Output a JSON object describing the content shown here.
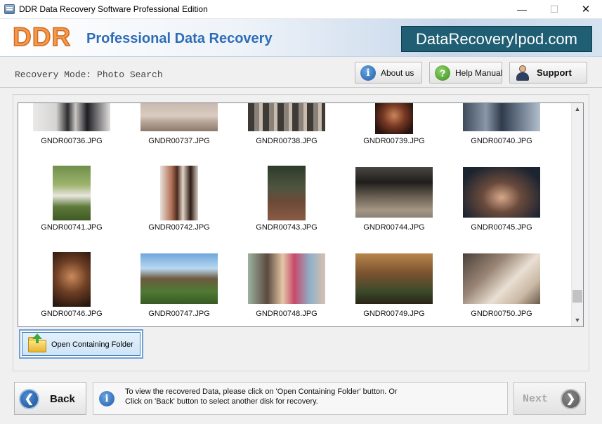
{
  "window": {
    "title": "DDR Data Recovery Software Professional Edition",
    "min_glyph": "—",
    "max_glyph": "☐",
    "close_glyph": "✕"
  },
  "banner": {
    "logo": "DDR",
    "title": "Professional Data Recovery",
    "site": "DataRecoveryIpod.com"
  },
  "toolbar": {
    "mode": "Recovery Mode: Photo Search",
    "about": "About us",
    "help": "Help Manual",
    "support": "Support",
    "info_glyph": "i",
    "help_glyph": "?"
  },
  "gallery": {
    "files": [
      "GNDR00736.JPG",
      "GNDR00737.JPG",
      "GNDR00738.JPG",
      "GNDR00739.JPG",
      "GNDR00740.JPG",
      "GNDR00741.JPG",
      "GNDR00742.JPG",
      "GNDR00743.JPG",
      "GNDR00744.JPG",
      "GNDR00745.JPG",
      "GNDR00746.JPG",
      "GNDR00747.JPG",
      "GNDR00748.JPG",
      "GNDR00749.JPG",
      "GNDR00750.JPG"
    ],
    "scroll_up": "▲",
    "scroll_down": "▼"
  },
  "open_folder": {
    "label": "Open Containing Folder"
  },
  "footer": {
    "back": "Back",
    "back_glyph": "❮",
    "info_glyph": "i",
    "info_line1": "To view the recovered Data, please click on 'Open Containing Folder' button. Or",
    "info_line2": "Click on 'Back' button to select another disk for recovery.",
    "next": "Next",
    "next_glyph": "❯"
  }
}
